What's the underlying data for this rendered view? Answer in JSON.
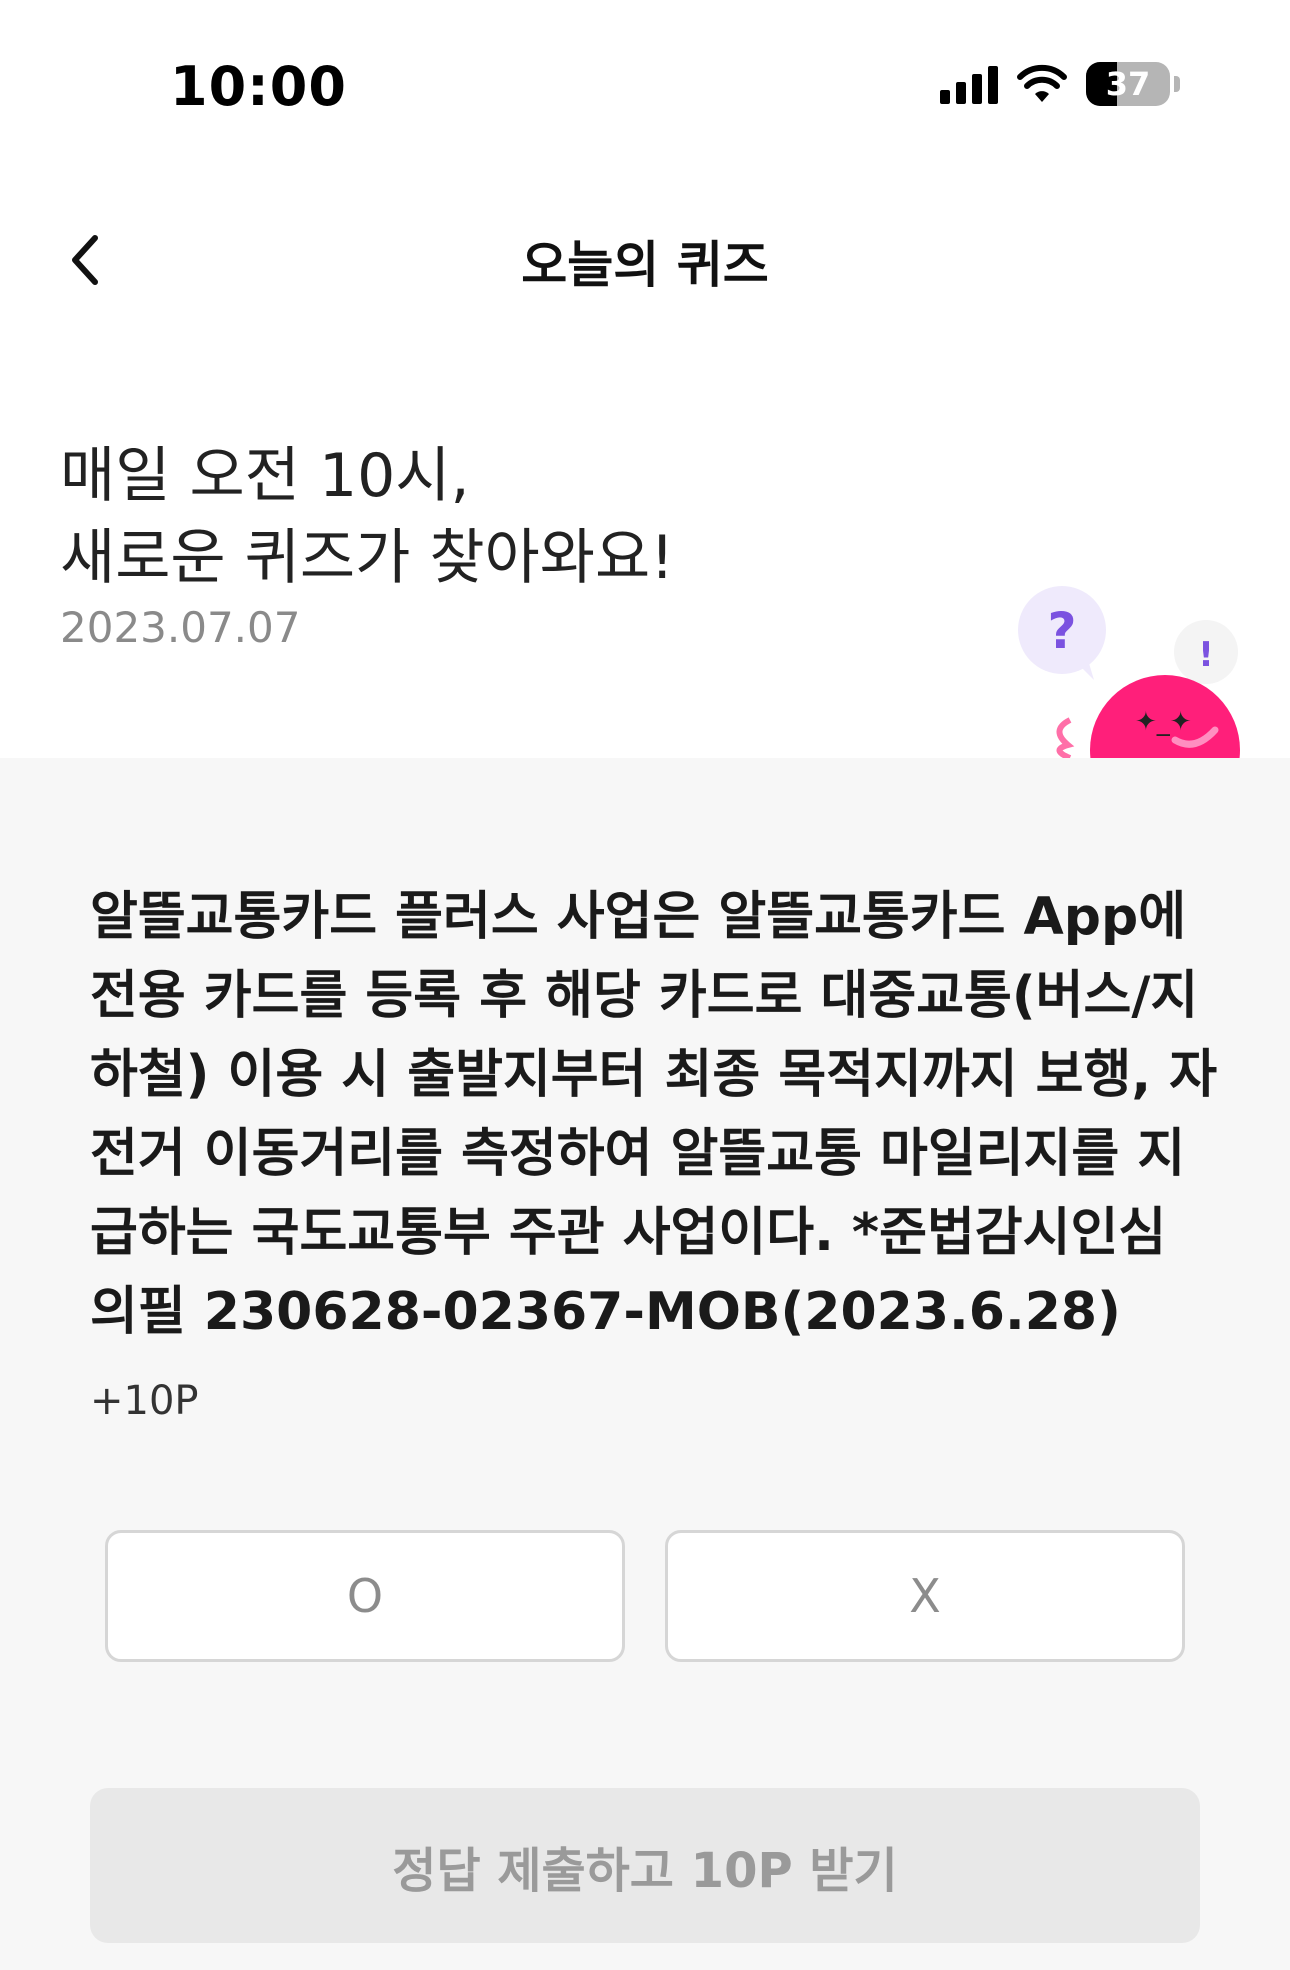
{
  "status_bar": {
    "time": "10:00",
    "battery_level": "37",
    "battery_fraction": 0.37
  },
  "nav": {
    "title": "오늘의 퀴즈",
    "back_icon": "chevron-left-icon"
  },
  "header": {
    "headline_lines": [
      "매일 오전 10시,",
      "새로운 퀴즈가 찾아와요!"
    ],
    "date": "2023.07.07",
    "mascot_question_mark": "?",
    "mascot_exclamation": "!"
  },
  "quiz": {
    "question_lines": [
      "알뜰교통카드 플러스 사업은 알뜰교통카드 App에",
      "전용 카드를 등록 후 해당 카드로 대중교통(버스/지",
      "하철) 이용 시 출발지부터 최종 목적지까지 보행, 자",
      "전거 이동거리를 측정하여 알뜰교통 마일리지를 지",
      "급하는 국도교통부 주관 사업이다. *준법감시인심",
      "의필 230628-02367-MOB(2023.6.28)"
    ],
    "points": "+10P",
    "option_o": "O",
    "option_x": "X",
    "submit_label": "정답 제출하고 10P 받기"
  },
  "colors": {
    "accent_pink": "#ff1f7a",
    "bubble_purple": "#7b52e0",
    "content_bg": "#f7f7f7"
  }
}
